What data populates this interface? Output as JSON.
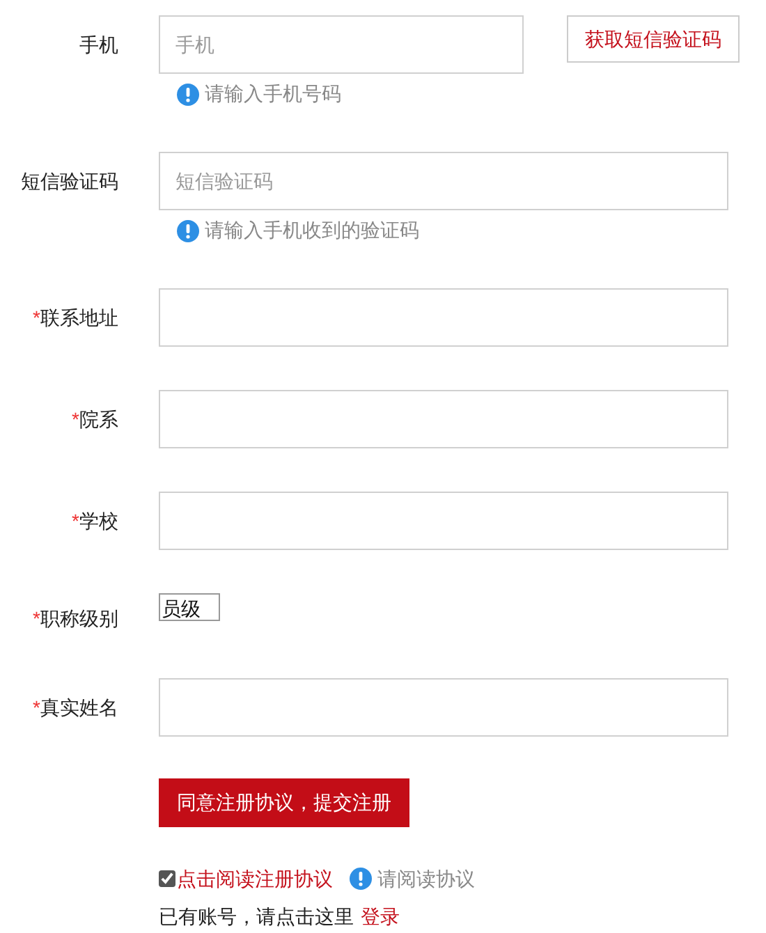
{
  "required_mark": "*",
  "fields": [
    {
      "label": "手机",
      "required": false,
      "kind": "text",
      "placeholder": "手机",
      "hint": "请输入手机号码",
      "action": "获取短信验证码"
    },
    {
      "label": "短信验证码",
      "required": false,
      "kind": "text",
      "placeholder": "短信验证码",
      "hint": "请输入手机收到的验证码"
    },
    {
      "label": "联系地址",
      "required": true,
      "kind": "text"
    },
    {
      "label": "院系",
      "required": true,
      "kind": "text"
    },
    {
      "label": "学校",
      "required": true,
      "kind": "text"
    },
    {
      "label": "职称级别",
      "required": true,
      "kind": "select",
      "value": "员级"
    },
    {
      "label": "真实姓名",
      "required": true,
      "kind": "text"
    }
  ],
  "submit": "同意注册协议，提交注册",
  "agreement": {
    "checked": true,
    "link": "点击阅读注册协议",
    "hint": "请阅读协议"
  },
  "login": {
    "text": "已有账号，请点击这里",
    "link": "登录"
  }
}
